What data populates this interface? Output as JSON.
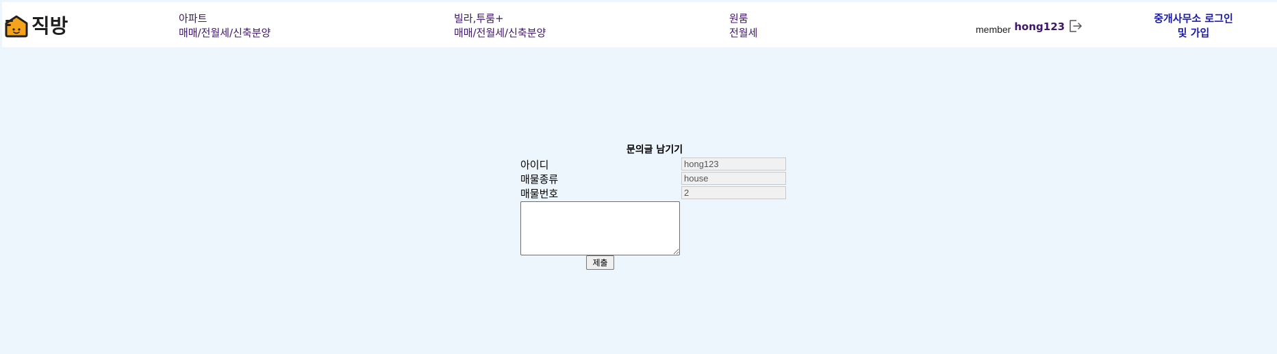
{
  "header": {
    "logo_text": "직방",
    "nav": [
      {
        "line1": "아파트",
        "line2": "매매/전월세/신축분양"
      },
      {
        "line1": "빌라,투룸+",
        "line2": "매매/전월세/신축분양"
      },
      {
        "line1": "원룸",
        "line2": "전월세"
      }
    ],
    "member_label": "member",
    "member_id": "hong123",
    "broker_line1": "중개사무소 로그인",
    "broker_line2": "및 가입"
  },
  "form": {
    "title": "문의글 남기기",
    "fields": [
      {
        "label": "아이디",
        "value": "hong123"
      },
      {
        "label": "매물종류",
        "value": "house"
      },
      {
        "label": "매물번호",
        "value": "2"
      }
    ],
    "message_value": "",
    "submit_label": "제출"
  },
  "colors": {
    "page_background": "#eef6fd",
    "header_background": "#ffffff",
    "nav_text": "#3d1668",
    "broker_link": "#1a1aa6",
    "logo_orange": "#f5a21c"
  },
  "icons": {
    "logo": "house-logo-icon",
    "logout": "logout-icon"
  }
}
